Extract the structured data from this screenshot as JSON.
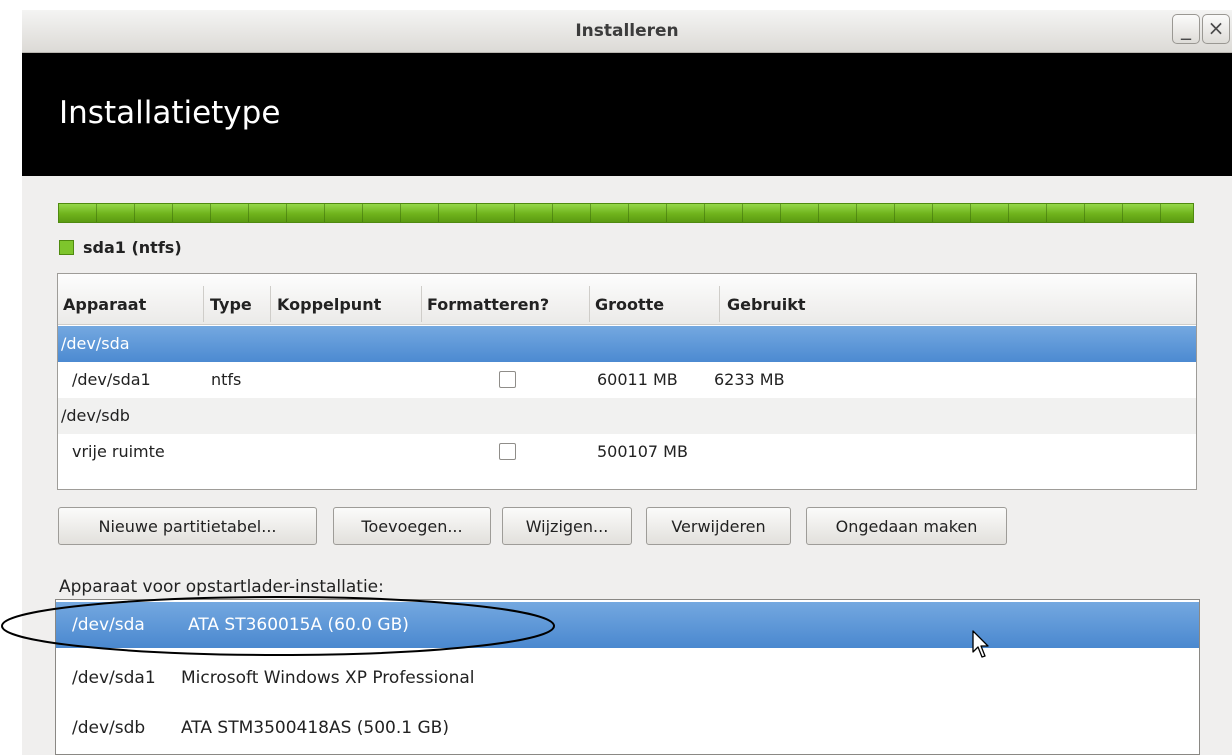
{
  "window": {
    "title": "Installeren",
    "minimize_glyph": "_",
    "close_glyph": "×"
  },
  "header": {
    "title": "Installatietype"
  },
  "partition_bar": {
    "legend": "sda1 (ntfs)",
    "color": "#7ec52c"
  },
  "table": {
    "columns": [
      "Apparaat",
      "Type",
      "Koppelpunt",
      "Formatteren?",
      "Grootte",
      "Gebruikt"
    ],
    "rows": [
      {
        "device": "/dev/sda",
        "type": "",
        "mount": "",
        "format": null,
        "size": "",
        "used": "",
        "selected": true
      },
      {
        "device": "/dev/sda1",
        "type": "ntfs",
        "mount": "",
        "format": false,
        "size": "60011 MB",
        "used": "6233 MB",
        "selected": false
      },
      {
        "device": "/dev/sdb",
        "type": "",
        "mount": "",
        "format": null,
        "size": "",
        "used": "",
        "selected": false
      },
      {
        "device": "vrije ruimte",
        "type": "",
        "mount": "",
        "format": false,
        "size": "500107 MB",
        "used": "",
        "selected": false
      }
    ]
  },
  "buttons": {
    "new_table": "Nieuwe partitietabel...",
    "add": "Toevoegen...",
    "change": "Wijzigen...",
    "remove": "Verwijderen",
    "undo": "Ongedaan maken"
  },
  "bootloader": {
    "label": "Apparaat voor opstartlader-installatie:",
    "options": [
      {
        "device": "/dev/sda",
        "desc": "ATA ST360015A (60.0 GB)",
        "selected": true
      },
      {
        "device": "/dev/sda1",
        "desc": "Microsoft Windows XP Professional",
        "selected": false
      },
      {
        "device": "/dev/sdb",
        "desc": "ATA STM3500418AS (500.1 GB)",
        "selected": false
      }
    ]
  },
  "colors": {
    "selection": "#4c8ad1",
    "header_bg": "#000000",
    "partition_green": "#7ec52c"
  }
}
